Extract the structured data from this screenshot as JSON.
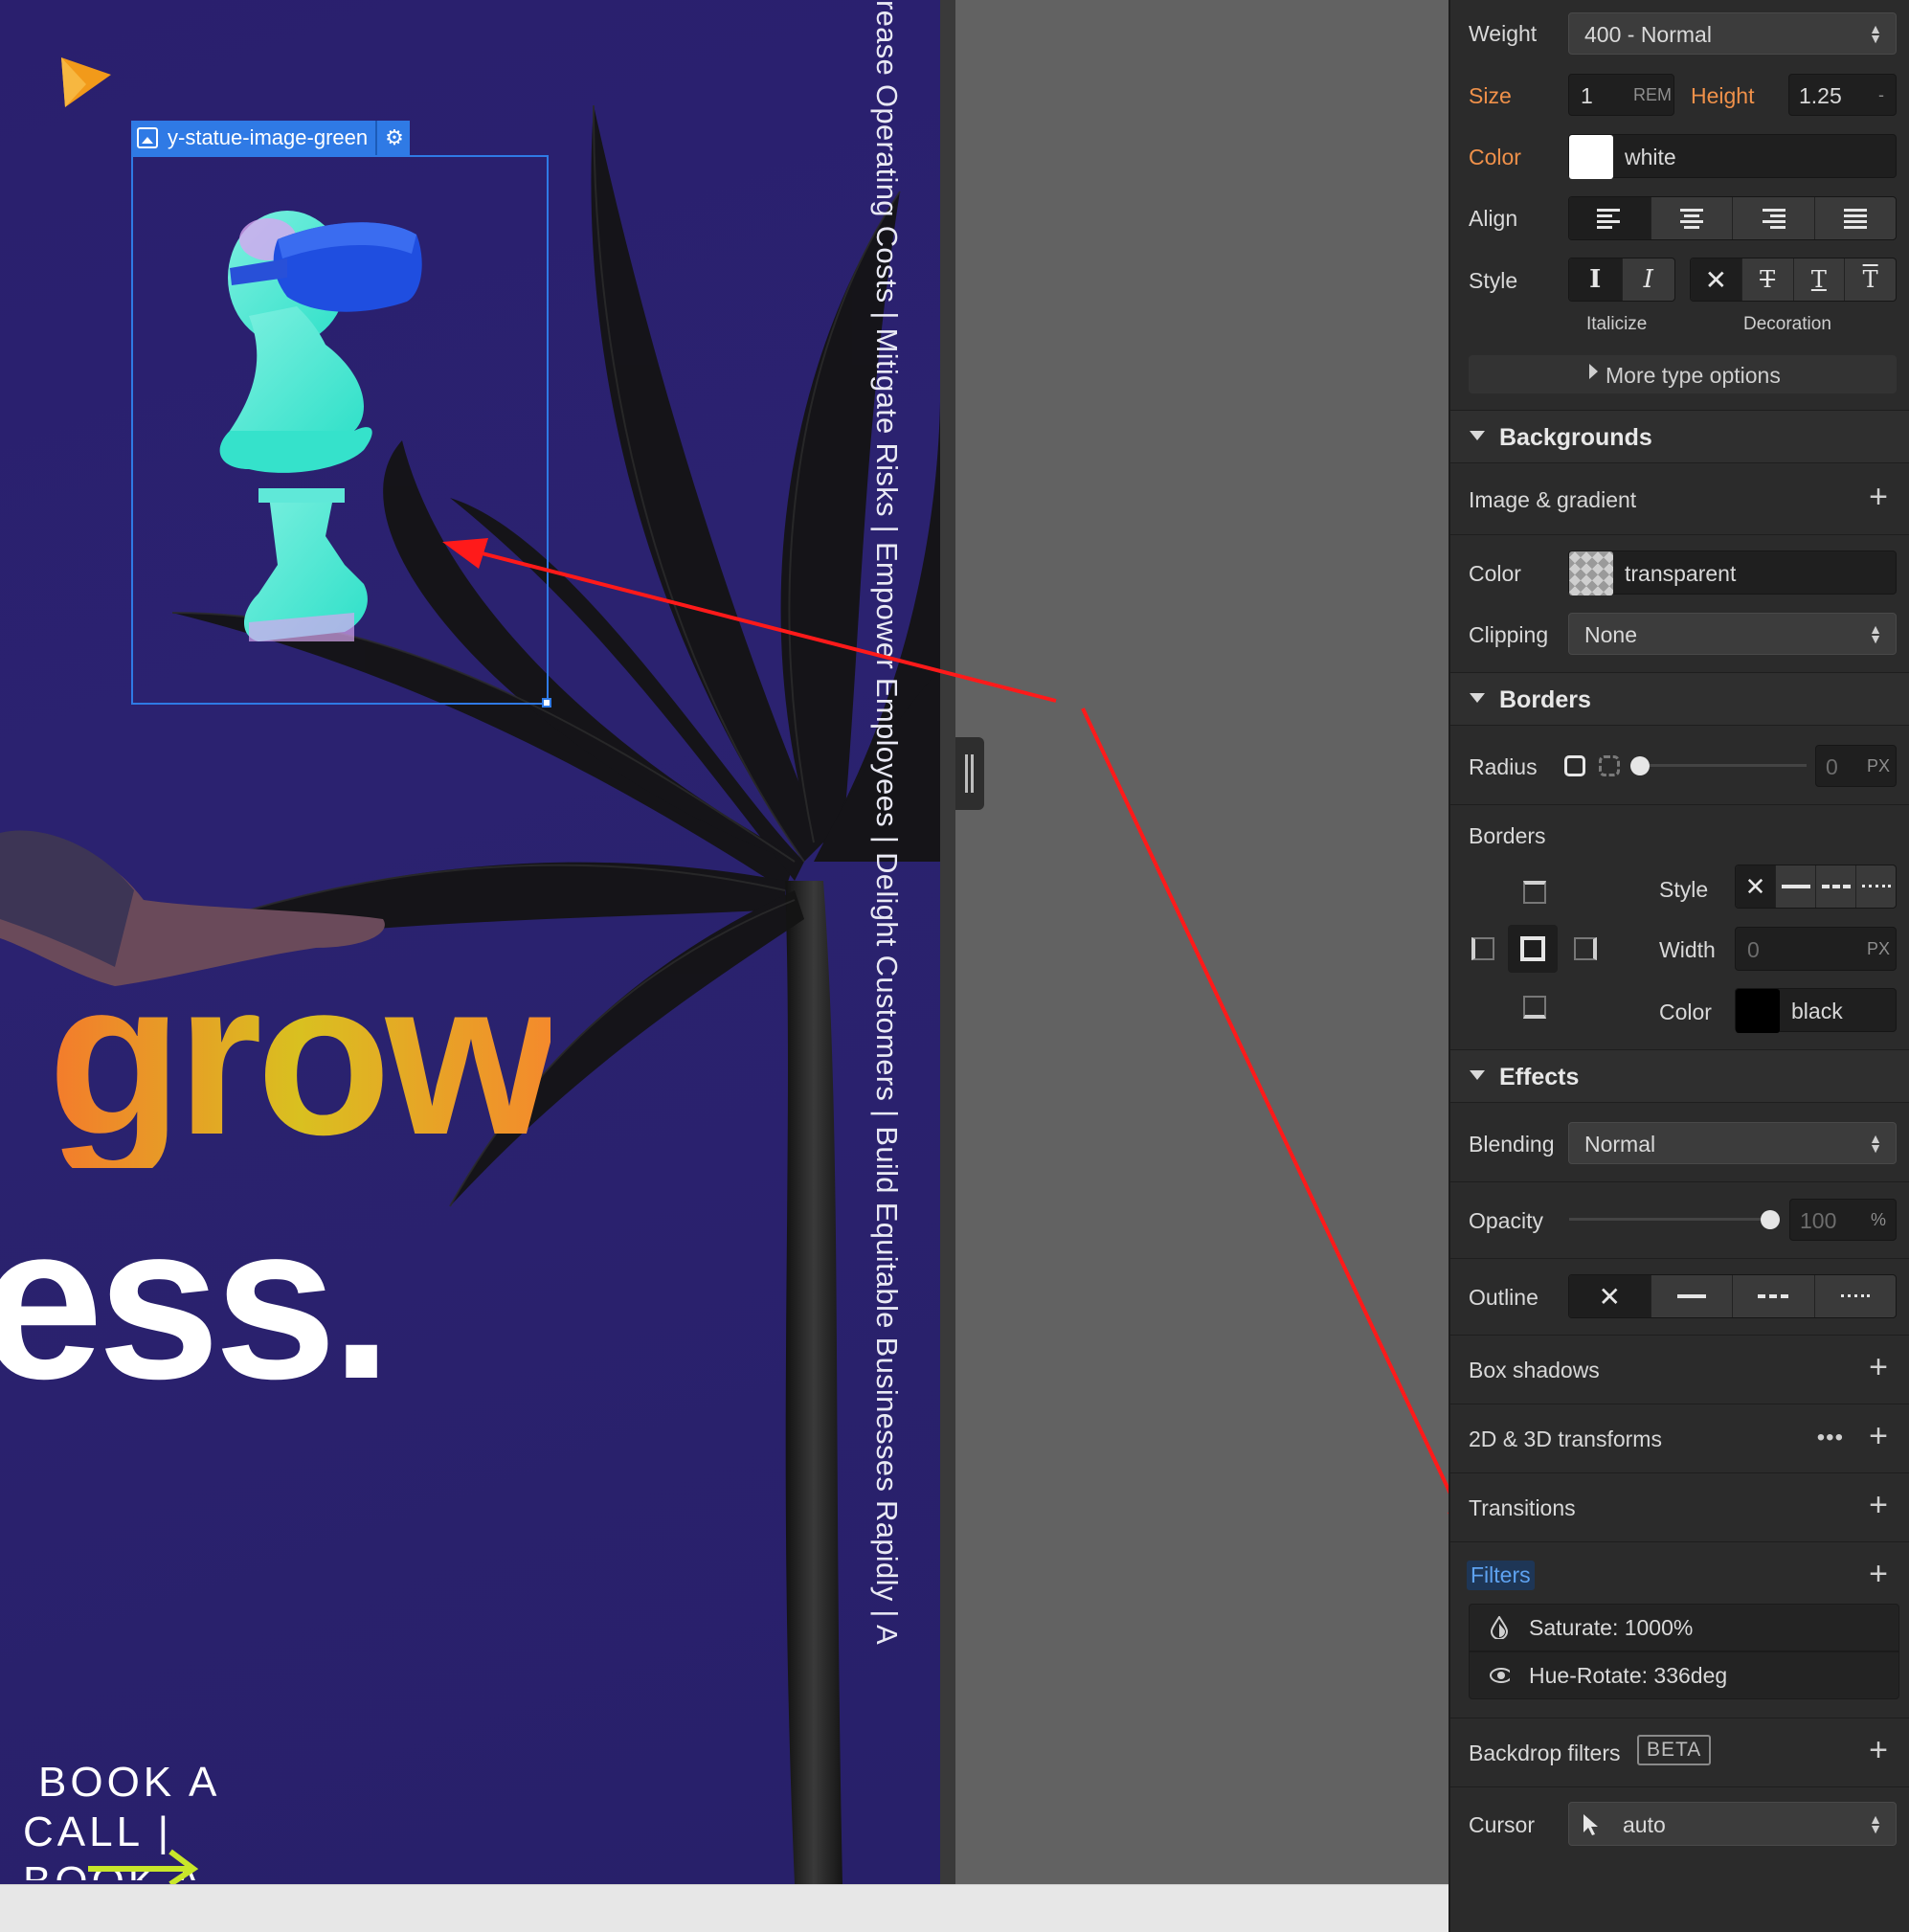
{
  "canvas": {
    "selected_element": "y-statue-image-green",
    "vertical_ticker": "rease Operating Costs  |  Mitigate Risks  |  Empower Employees  |  Delight Customers  |  Build Equitable Businesses Rapidly  |  A",
    "headline_line1": "grow",
    "headline_line2": "ess.",
    "cta_line1": "BOOK A",
    "cta_line2": "CALL |",
    "cta_line3": "BOOK A"
  },
  "typography": {
    "weight_label": "Weight",
    "weight_value": "400 - Normal",
    "size_label": "Size",
    "size_value": "1",
    "size_unit": "REM",
    "height_label": "Height",
    "height_value": "1.25",
    "height_unit": "-",
    "color_label": "Color",
    "color_value": "white",
    "align_label": "Align",
    "style_label": "Style",
    "italicize_caption": "Italicize",
    "decoration_caption": "Decoration",
    "more_options": "More type options"
  },
  "backgrounds": {
    "title": "Backgrounds",
    "image_gradient_label": "Image & gradient",
    "color_label": "Color",
    "color_value": "transparent",
    "clipping_label": "Clipping",
    "clipping_value": "None"
  },
  "borders": {
    "title": "Borders",
    "radius_label": "Radius",
    "radius_value": "0",
    "radius_unit": "PX",
    "borders_label": "Borders",
    "style_label": "Style",
    "width_label": "Width",
    "width_value": "0",
    "width_unit": "PX",
    "color_label": "Color",
    "color_value": "black"
  },
  "effects": {
    "title": "Effects",
    "blending_label": "Blending",
    "blending_value": "Normal",
    "opacity_label": "Opacity",
    "opacity_value": "100",
    "opacity_unit": "%",
    "opacity_level": 1.0,
    "outline_label": "Outline",
    "box_shadows_label": "Box shadows",
    "transforms_label": "2D & 3D transforms",
    "transitions_label": "Transitions",
    "filters_label": "Filters",
    "filter_items": [
      {
        "icon": "droplet-icon",
        "label": "Saturate: 1000%"
      },
      {
        "icon": "eye-icon",
        "label": "Hue-Rotate: 336deg"
      }
    ],
    "backdrop_filters_label": "Backdrop filters",
    "backdrop_badge": "BETA",
    "cursor_label": "Cursor",
    "cursor_value": "auto"
  },
  "colors": {
    "canvas_bg": "#2b2270",
    "panel_bg": "#2b2b2b",
    "selection_blue": "#2f7ae5",
    "label_orange": "#f0914a",
    "filters_label_blue": "#5ea2f0",
    "annotation_red": "#ff1a1a"
  }
}
